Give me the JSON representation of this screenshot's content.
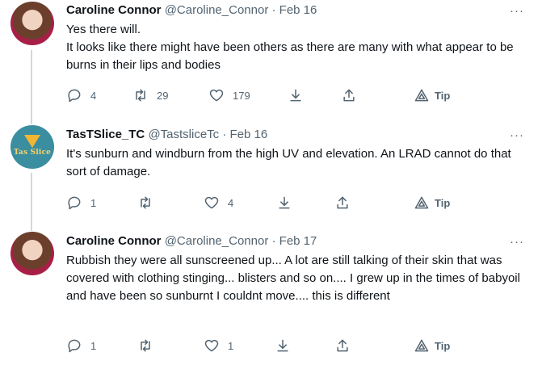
{
  "tweets": [
    {
      "author": "Caroline Connor",
      "handle": "@Caroline_Connor",
      "separator": "·",
      "date": "Feb 16",
      "avatar": "caroline-avatar",
      "lines": [
        "Yes there will.",
        "It looks like there might have been others as there are many with what appear to be burns in their lips and bodies"
      ],
      "replies": "4",
      "retweets": "29",
      "likes": "179",
      "tip": "Tip"
    },
    {
      "author": "TasTSlice_TC",
      "handle": "@TastsliceTc",
      "separator": "·",
      "date": "Feb 16",
      "avatar": "tas-slice-logo",
      "avatar_text": "Tas Slice",
      "lines": [
        "It's sunburn and windburn from the high UV and elevation. An LRAD cannot do that sort of damage."
      ],
      "replies": "1",
      "retweets": "",
      "likes": "4",
      "tip": "Tip"
    },
    {
      "author": "Caroline Connor",
      "handle": "@Caroline_Connor",
      "separator": "·",
      "date": "Feb 17",
      "avatar": "caroline-avatar",
      "lines": [
        "Rubbish they were all sunscreened up... A lot are still talking of their skin that was covered with clothing stinging... blisters and so on.... I grew up in the times of babyoil and have been so sunburnt I couldnt move.... this is different"
      ],
      "replies": "1",
      "retweets": "",
      "likes": "1",
      "tip": "Tip"
    }
  ],
  "more_label": "···",
  "colors": {
    "text": "#0f1419",
    "secondary": "#536471",
    "thread_line": "#cfd9de"
  },
  "icons": [
    "reply-icon",
    "retweet-icon",
    "like-icon",
    "bookmark-icon",
    "share-icon",
    "tip-icon",
    "more-icon"
  ]
}
